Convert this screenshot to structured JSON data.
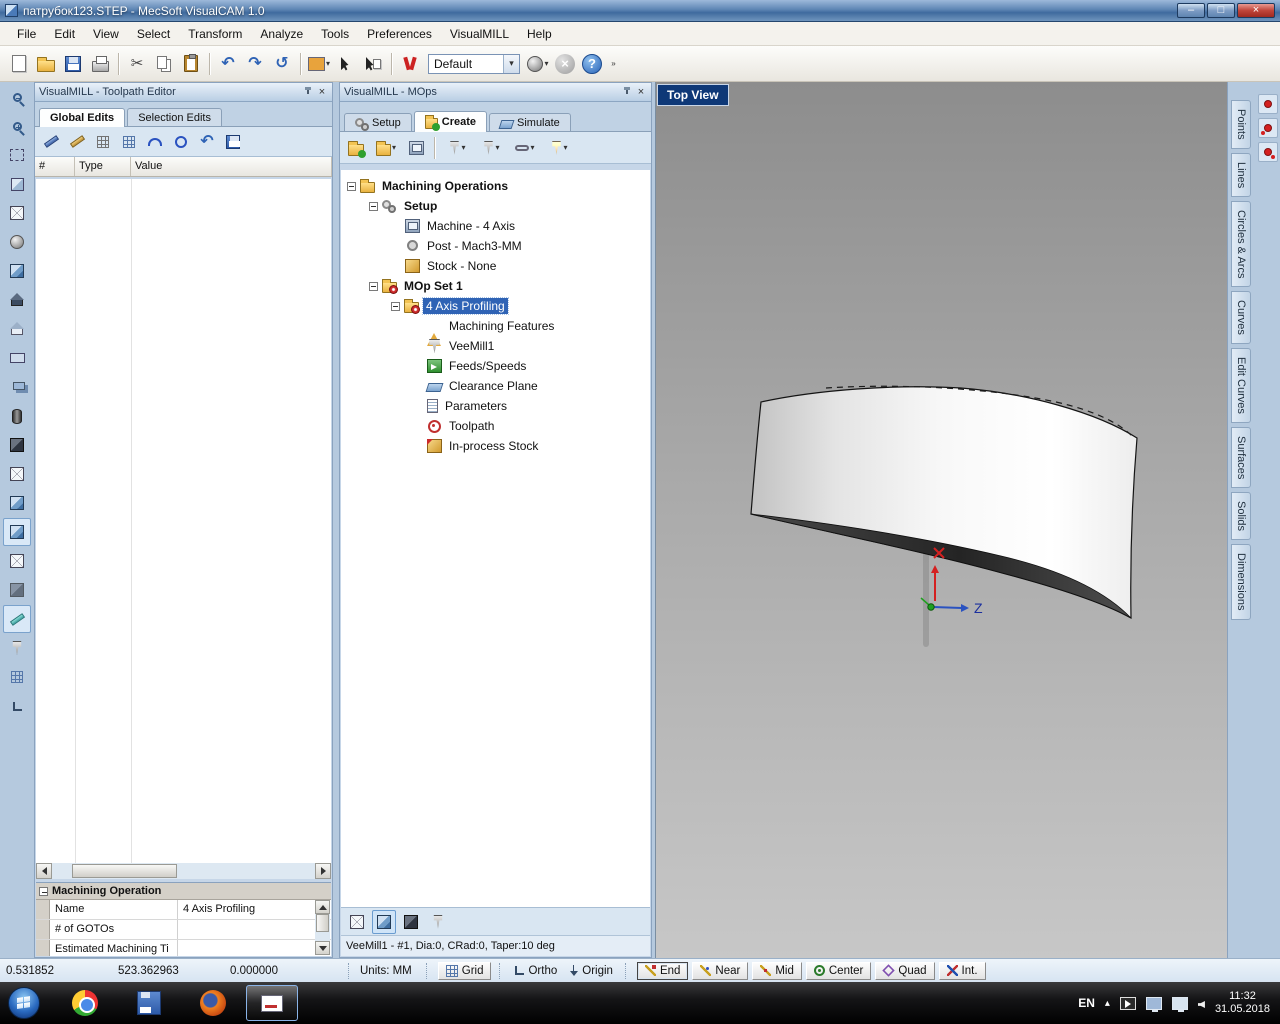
{
  "glyphs": {
    "minimize": "–",
    "restore": "□",
    "close": "×",
    "dropdown": "▾",
    "cut": "✂",
    "undo": "↶",
    "redo": "↷",
    "redo_alt": "↺",
    "help": "?",
    "overflow": "»",
    "tray_up": "▴"
  },
  "window": {
    "title": "патрубок123.STEP - MecSoft VisualCAM 1.0"
  },
  "menu": {
    "items": [
      "File",
      "Edit",
      "View",
      "Select",
      "Transform",
      "Analyze",
      "Tools",
      "Preferences",
      "VisualMILL",
      "Help"
    ]
  },
  "main_toolbar": {
    "profile_combo": "Default"
  },
  "toolpath_editor": {
    "title": "VisualMILL - Toolpath Editor",
    "tabs": [
      "Global Edits",
      "Selection Edits"
    ],
    "columns": [
      "#",
      "Type",
      "Value"
    ],
    "props_title": "Machining Operation",
    "props": [
      {
        "label": "Name",
        "value": "4 Axis Profiling"
      },
      {
        "label": "# of GOTOs",
        "value": ""
      },
      {
        "label": "Estimated Machining Ti",
        "value": ""
      }
    ]
  },
  "mops": {
    "title": "VisualMILL - MOps",
    "tabs": [
      "Setup",
      "Create",
      "Simulate"
    ],
    "tree": [
      {
        "label": "Machining Operations"
      },
      {
        "label": "Setup"
      },
      {
        "label": "Machine - 4 Axis"
      },
      {
        "label": "Post - Mach3-MM"
      },
      {
        "label": "Stock - None"
      },
      {
        "label": "MOp Set 1"
      },
      {
        "label": "4 Axis Profiling"
      },
      {
        "label": "Machining Features"
      },
      {
        "label": "VeeMill1"
      },
      {
        "label": "Feeds/Speeds"
      },
      {
        "label": "Clearance Plane"
      },
      {
        "label": "Parameters"
      },
      {
        "label": "Toolpath"
      },
      {
        "label": "In-process Stock"
      }
    ],
    "status": "VeeMill1 - #1, Dia:0, CRad:0, Taper:10 deg"
  },
  "viewport": {
    "view_label": "Top View",
    "z_axis": "Z"
  },
  "right_tabs": {
    "items": [
      "Points",
      "Lines",
      "Circles & Arcs",
      "Curves",
      "Edit Curves",
      "Surfaces",
      "Solids",
      "Dimensions"
    ]
  },
  "status_bar": {
    "coord_x": "0.531852",
    "coord_y": "523.362963",
    "coord_z": "0.000000",
    "units": "Units: MM",
    "grid": "Grid",
    "ortho": "Ortho",
    "origin": "Origin",
    "snaps": [
      "End",
      "Near",
      "Mid",
      "Center",
      "Quad",
      "Int."
    ]
  },
  "taskbar": {
    "lang": "EN",
    "time": "11:32",
    "date": "31.05.2018"
  }
}
